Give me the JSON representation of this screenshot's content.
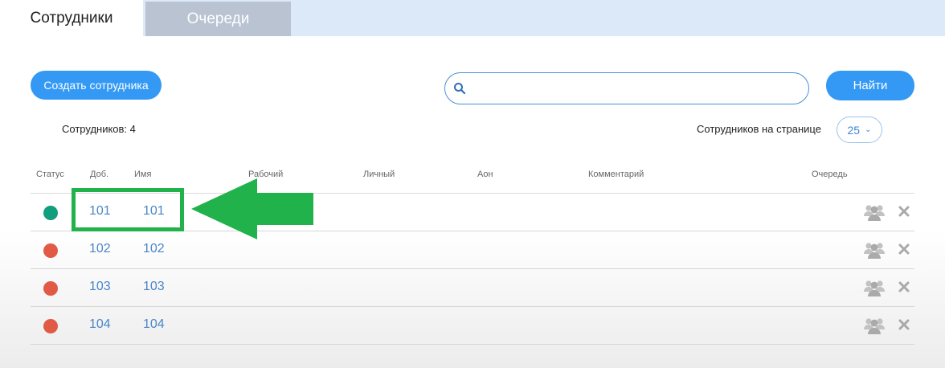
{
  "tabs": [
    {
      "label": "Сотрудники",
      "active": true
    },
    {
      "label": "Очереди",
      "active": false
    }
  ],
  "toolbar": {
    "create_label": "Создать сотрудника",
    "search_value": "",
    "search_placeholder": "",
    "find_label": "Найти"
  },
  "summary": {
    "count_text": "Сотрудников: 4",
    "per_page_label": "Сотрудников на странице",
    "per_page_value": "25"
  },
  "table": {
    "headers": {
      "status": "Статус",
      "ext": "Доб.",
      "name": "Имя",
      "work": "Рабочий",
      "personal": "Личный",
      "aon": "Аон",
      "comment": "Комментарий",
      "queue": "Очередь"
    },
    "rows": [
      {
        "status": "online",
        "ext": "101",
        "name": "101"
      },
      {
        "status": "offline",
        "ext": "102",
        "name": "102"
      },
      {
        "status": "offline",
        "ext": "103",
        "name": "103"
      },
      {
        "status": "offline",
        "ext": "104",
        "name": "104"
      }
    ]
  },
  "colors": {
    "accent": "#3399f5",
    "status_online": "#119e7c",
    "status_offline": "#e05a45",
    "highlight": "#22b24c"
  },
  "icons": {
    "search": "search-icon",
    "queue": "users-group-icon",
    "delete": "close-icon",
    "chevron": "chevron-down-icon",
    "annotation": "arrow-left-icon"
  }
}
